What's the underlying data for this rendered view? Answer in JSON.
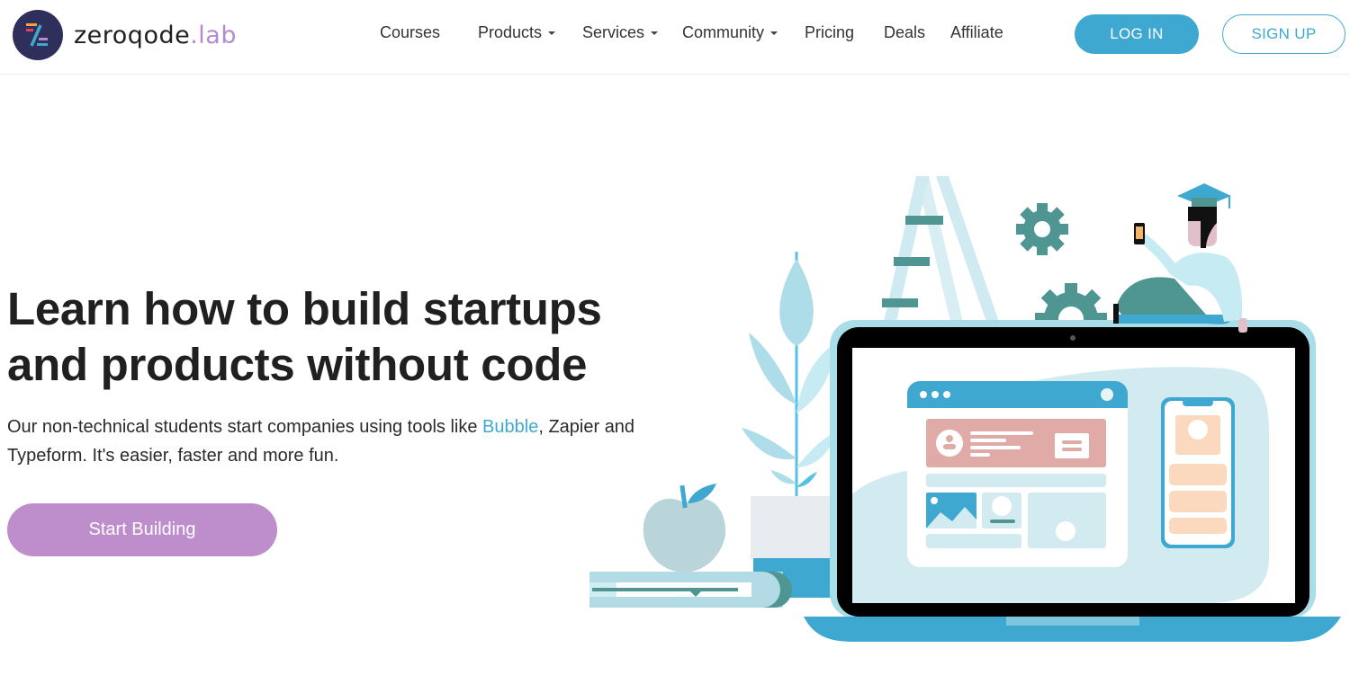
{
  "brand": {
    "name": "zeroqode",
    "suffix": ".lab",
    "colors": {
      "primary": "#3fa8d0",
      "accent": "#bd8ecb",
      "logo_bg": "#2e2f5b",
      "teal": "#4f9693"
    }
  },
  "nav": {
    "items": [
      {
        "label": "Courses",
        "dropdown": false
      },
      {
        "label": "Products",
        "dropdown": true
      },
      {
        "label": "Services",
        "dropdown": true
      },
      {
        "label": "Community",
        "dropdown": true
      },
      {
        "label": "Pricing",
        "dropdown": false
      },
      {
        "label": "Deals",
        "dropdown": false
      },
      {
        "label": "Affiliate",
        "dropdown": false
      }
    ],
    "login_label": "LOG IN",
    "signup_label": "SIGN UP"
  },
  "hero": {
    "title": "Learn how to build startups and products without code",
    "subtitle_before": "Our non-technical students start companies using tools like ",
    "subtitle_link": "Bubble",
    "subtitle_after": ", Zapier and Typeform. It's easier, faster and more fun.",
    "cta_label": "Start Building"
  },
  "illustration": {
    "description": "Graduate student sitting on laptop with web and mobile wireframes, gears, ladder, plant, apple and book",
    "icons": [
      "ladder-icon",
      "gear-icon",
      "graduate-icon",
      "phone-icon",
      "laptop-icon",
      "browser-window-icon",
      "mobile-phone-icon",
      "plant-icon",
      "apple-icon",
      "book-icon"
    ]
  }
}
